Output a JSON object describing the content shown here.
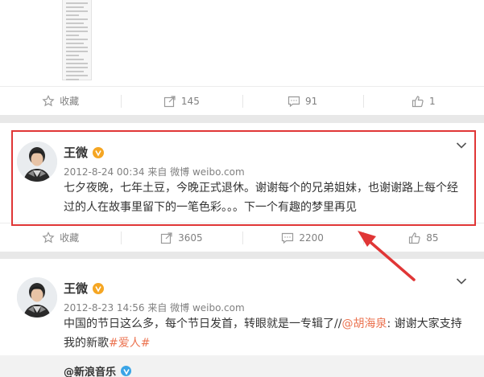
{
  "post1": {
    "actions": [
      {
        "icon": "star-icon",
        "label": "收藏"
      },
      {
        "icon": "share-icon",
        "label": "145"
      },
      {
        "icon": "comment-icon",
        "label": "91"
      },
      {
        "icon": "thumbs-up-icon",
        "label": "1"
      }
    ]
  },
  "post2": {
    "author": "王微",
    "meta": "2012-8-24 00:34 来自 微博 weibo.com",
    "text_line1": "七夕夜晚，七年土豆，今晚正式退休。谢谢每个的兄弟姐妹，也谢谢路上每个经",
    "text_line2": "过的人在故事里留下的一笔色彩。。。下一个有趣的梦里再见",
    "actions": [
      {
        "icon": "star-icon",
        "label": "收藏"
      },
      {
        "icon": "share-icon",
        "label": "3605"
      },
      {
        "icon": "comment-icon",
        "label": "2200"
      },
      {
        "icon": "thumbs-up-icon",
        "label": "85"
      }
    ]
  },
  "post3": {
    "author": "王微",
    "meta": "2012-8-23 14:56 来自 微博 weibo.com",
    "text_part1": "中国的节日这么多，每个节日发首，转眼就是一专辑了//",
    "mention": "@胡海泉",
    "text_part2": ": 谢谢大家支持",
    "text_line2_plain": "我的新歌",
    "hashtag": "#爱人#",
    "repost_author": "@新浪音乐"
  },
  "colors": {
    "highlight": "#e03636",
    "link": "#eb7350",
    "verified_gold": "#f5a623",
    "verified_blue": "#3aa4e6"
  }
}
